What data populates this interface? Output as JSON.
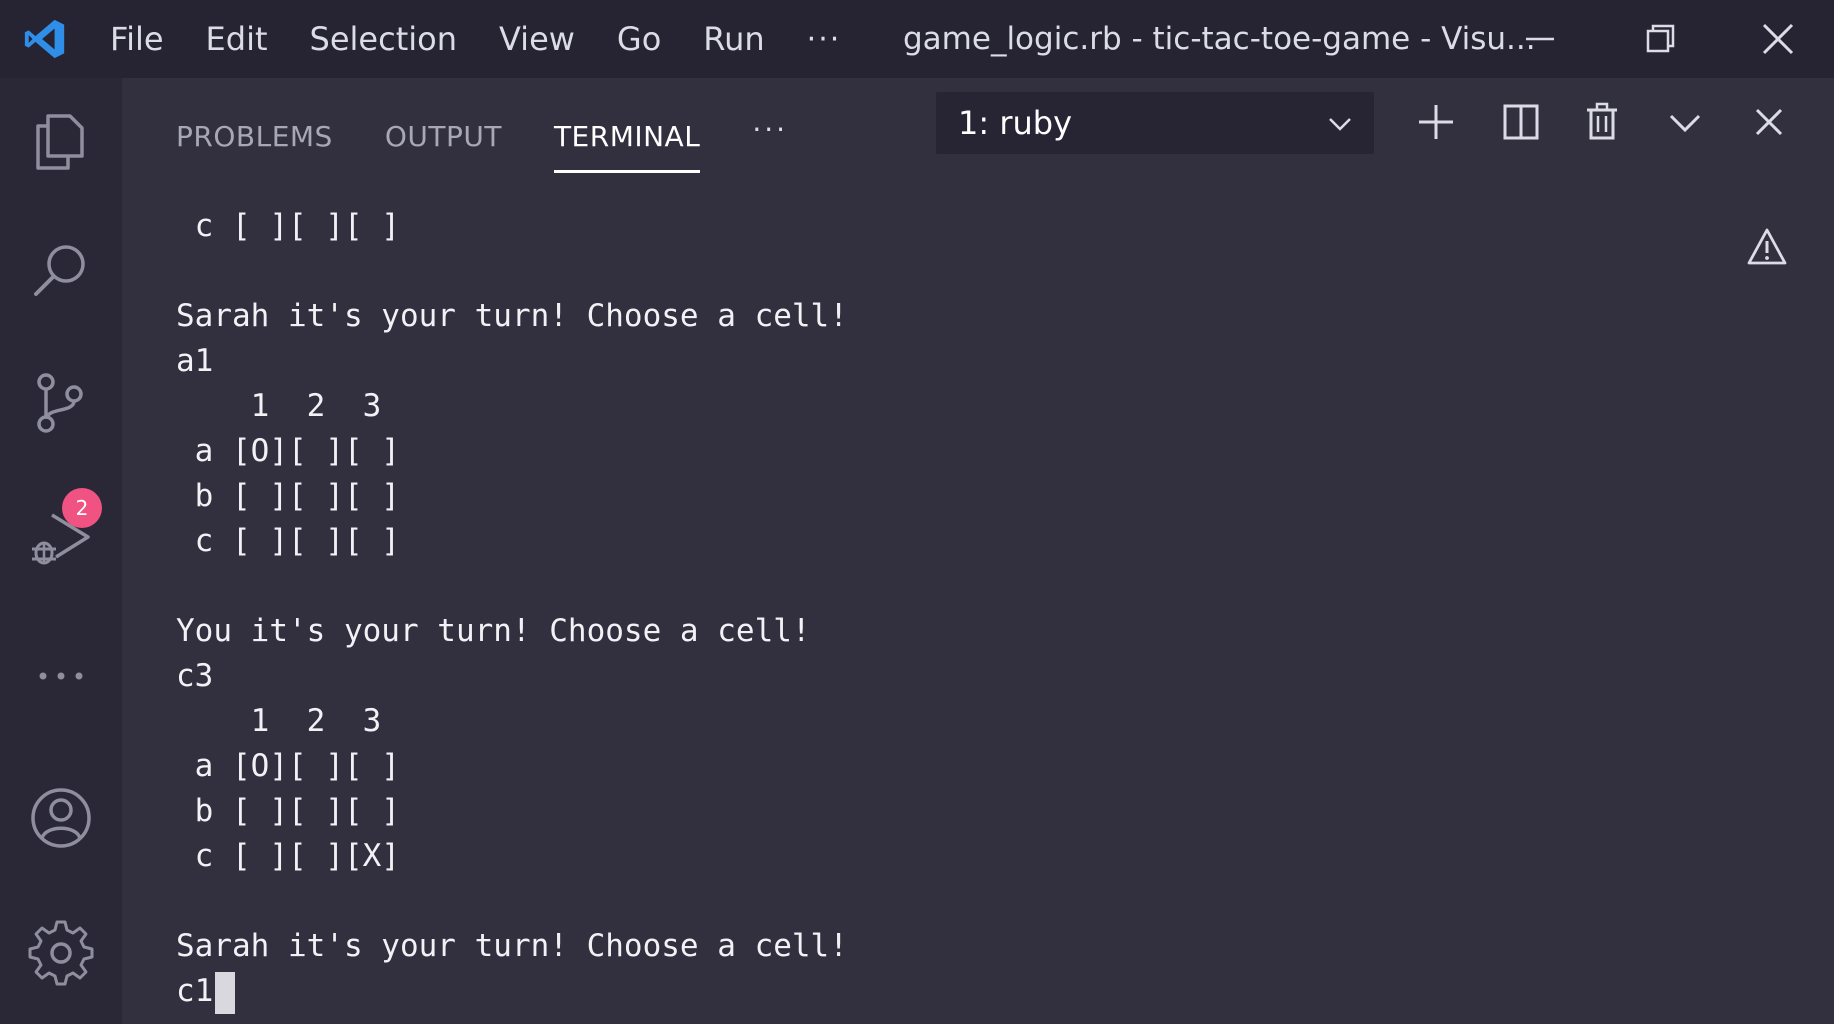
{
  "titlebar": {
    "menu": [
      "File",
      "Edit",
      "Selection",
      "View",
      "Go",
      "Run"
    ],
    "more": "···",
    "window_title": "game_logic.rb - tic-tac-toe-game - Visu..."
  },
  "activitybar": {
    "icons": [
      "explorer-icon",
      "search-icon",
      "source-control-icon",
      "run-debug-icon",
      "more-icon",
      "account-icon",
      "settings-icon"
    ],
    "scm_badge": "2",
    "more": "···"
  },
  "panel": {
    "tabs": [
      "PROBLEMS",
      "OUTPUT",
      "TERMINAL"
    ],
    "active_tab": "TERMINAL",
    "more": "···",
    "terminal_select": "1: ruby"
  },
  "terminal": {
    "lines": [
      " c [ ][ ][ ]",
      "",
      "Sarah it's your turn! Choose a cell!",
      "a1",
      "    1  2  3",
      " a [O][ ][ ]",
      " b [ ][ ][ ]",
      " c [ ][ ][ ]",
      "",
      "You it's your turn! Choose a cell!",
      "c3",
      "    1  2  3",
      " a [O][ ][ ]",
      " b [ ][ ][ ]",
      " c [ ][ ][X]",
      "",
      "Sarah it's your turn! Choose a cell!"
    ],
    "input_line": "c1"
  },
  "colors": {
    "titlebar_bg": "#262433",
    "activitybar_bg": "#2a2837",
    "panel_bg": "#32303f",
    "accent": "#2f8ee8",
    "badge": "#f05281"
  }
}
